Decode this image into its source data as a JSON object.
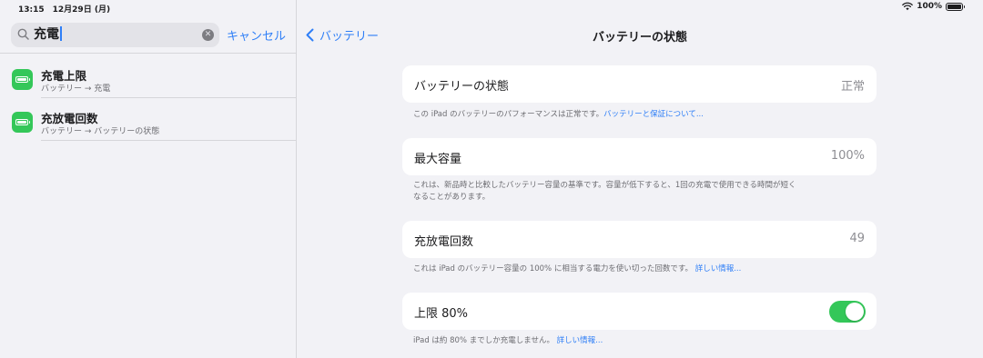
{
  "status_bar": {
    "time_date": "13:15　12月29日 (月)",
    "battery_percent": "100%",
    "wifi_icon": "wifi-icon",
    "battery_icon": "battery-full-icon"
  },
  "search": {
    "value": "充電",
    "clear_icon": "clear-icon",
    "cancel_label": "キャンセル"
  },
  "results": [
    {
      "title": "充電上限",
      "path": "バッテリー → 充電",
      "icon": "battery-app-icon"
    },
    {
      "title": "充放電回数",
      "path": "バッテリー → バッテリーの状態",
      "icon": "battery-app-icon"
    }
  ],
  "nav": {
    "back_label": "バッテリー",
    "title": "バッテリーの状態"
  },
  "sections": [
    {
      "label": "バッテリーの状態",
      "value": "正常",
      "footnote": "この iPad のバッテリーのパフォーマンスは正常です。",
      "footnote_link": "バッテリーと保証について..."
    },
    {
      "label": "最大容量",
      "value": "100%",
      "footnote_line1": "これは、新品時と比較したバッテリー容量の基準です。容量が低下すると、1回の充電で使用できる時間が短く",
      "footnote_line2": "なることがあります。"
    },
    {
      "label": "充放電回数",
      "value": "49",
      "footnote": "これは iPad のバッテリー容量の 100% に相当する電力を使い切った回数です。",
      "footnote_link": "詳しい情報..."
    },
    {
      "label": "上限 80%",
      "toggle_on": true,
      "footnote": "iPad は約 80% までしか充電しません。",
      "footnote_link": "詳しい情報..."
    }
  ],
  "colors": {
    "accent": "#2f7ff7",
    "toggle_on": "#34c759",
    "background": "#f2f2f6"
  }
}
